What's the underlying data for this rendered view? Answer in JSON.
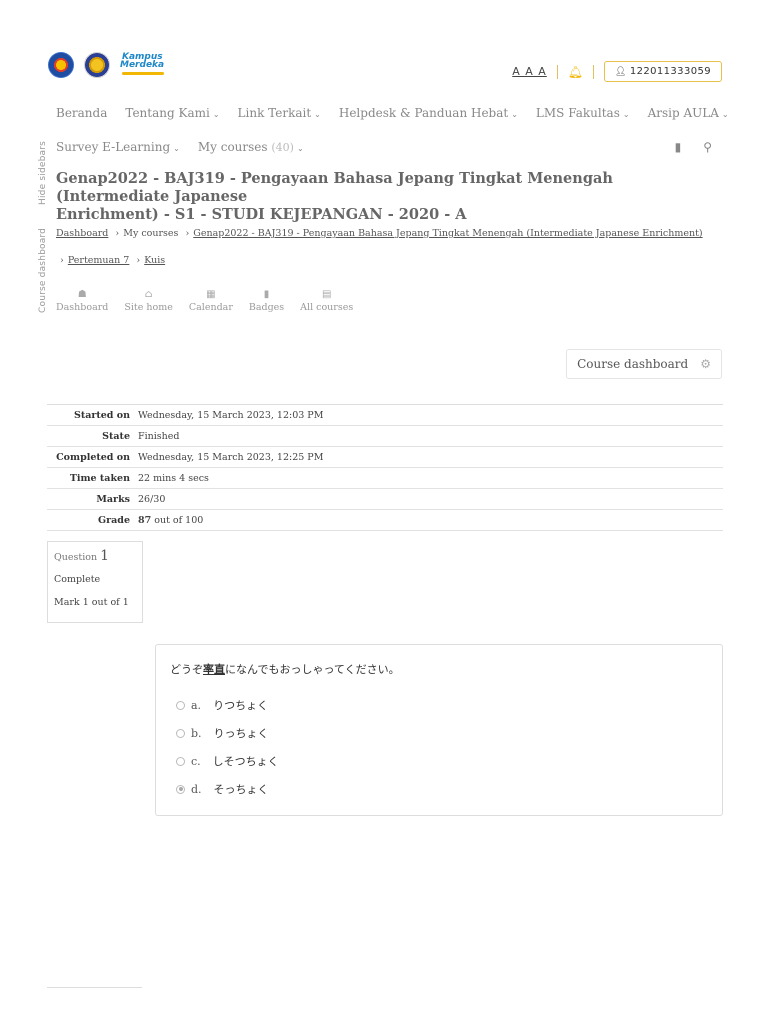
{
  "side_tabs": {
    "hide_sidebars": "Hide sidebars",
    "course_dashboard": "Course dashboard"
  },
  "header": {
    "logo_text_1": "Kampus",
    "logo_text_2": "Merdeka",
    "font_size_label": "A A A",
    "bell_icon": "bell-icon",
    "user_id": "122011333059"
  },
  "nav_primary": [
    {
      "label": "Beranda",
      "dropdown": false
    },
    {
      "label": "Tentang Kami",
      "dropdown": true
    },
    {
      "label": "Link Terkait",
      "dropdown": true
    },
    {
      "label": "Helpdesk & Panduan Hebat",
      "dropdown": true
    },
    {
      "label": "LMS Fakultas",
      "dropdown": true
    },
    {
      "label": "Arsip AULA",
      "dropdown": true
    }
  ],
  "nav_secondary": {
    "survey": "Survey E-Learning",
    "my_courses": "My courses",
    "my_courses_count": "(40)"
  },
  "course": {
    "title_line1": "Genap2022 - BAJ319 - Pengayaan Bahasa Jepang Tingkat Menengah (Intermediate Japanese",
    "title_line2": "Enrichment) - S1 - STUDI KEJEPANGAN - 2020 - A"
  },
  "breadcrumb": {
    "dashboard": "Dashboard",
    "my_courses": "My courses",
    "course": "Genap2022 - BAJ319 - Pengayaan Bahasa Jepang Tingkat Menengah (Intermediate Japanese Enrichment)",
    "section": "Pertemuan 7",
    "activity": "Kuis"
  },
  "quick_nav": [
    {
      "icon": "dashboard-icon",
      "glyph": "☗",
      "label": "Dashboard"
    },
    {
      "icon": "home-icon",
      "glyph": "⌂",
      "label": "Site home"
    },
    {
      "icon": "calendar-icon",
      "glyph": "▦",
      "label": "Calendar"
    },
    {
      "icon": "badge-icon",
      "glyph": "▮",
      "label": "Badges"
    },
    {
      "icon": "book-icon",
      "glyph": "▤",
      "label": "All courses"
    }
  ],
  "course_dashboard_button": "Course dashboard",
  "summary": [
    {
      "label": "Started on",
      "value": "Wednesday, 15 March 2023, 12:03 PM"
    },
    {
      "label": "State",
      "value": "Finished"
    },
    {
      "label": "Completed on",
      "value": "Wednesday, 15 March 2023, 12:25 PM"
    },
    {
      "label": "Time taken",
      "value": "22 mins 4 secs"
    },
    {
      "label": "Marks",
      "value": "26/30"
    },
    {
      "label": "Grade",
      "value_bold": "87",
      "value": " out of 100"
    }
  ],
  "question_info": {
    "prefix": "Question",
    "number": "1",
    "state": "Complete",
    "mark": "Mark 1 out of 1"
  },
  "question": {
    "text_before": "どうぞ",
    "text_kanji": "率直",
    "text_after": "になんでもおっしゃってください。",
    "options": [
      {
        "letter": "a.",
        "text": "りつちょく",
        "selected": false
      },
      {
        "letter": "b.",
        "text": "りっちょく",
        "selected": false
      },
      {
        "letter": "c.",
        "text": "しそつちょく",
        "selected": false
      },
      {
        "letter": "d.",
        "text": "そっちょく",
        "selected": true
      }
    ]
  }
}
